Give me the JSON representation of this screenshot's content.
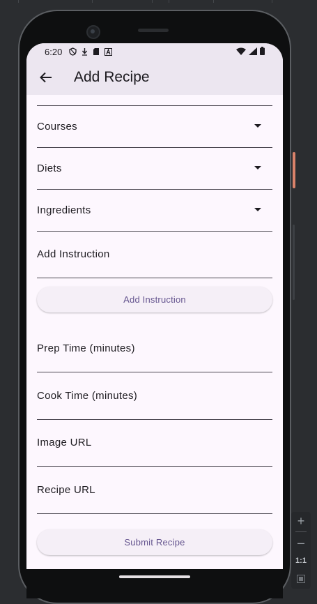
{
  "status_bar": {
    "time": "6:20",
    "left_icons": [
      "shield-icon",
      "download-icon",
      "sd-card-icon",
      "font-icon"
    ],
    "right_icons": [
      "wifi-icon",
      "signal-icon",
      "battery-icon"
    ]
  },
  "app_bar": {
    "title": "Add Recipe"
  },
  "form": {
    "courses_label": "Courses",
    "diets_label": "Diets",
    "ingredients_label": "Ingredients",
    "instruction_placeholder": "Add Instruction",
    "add_instruction_button": "Add Instruction",
    "prep_time_placeholder": "Prep Time (minutes)",
    "cook_time_placeholder": "Cook Time (minutes)",
    "image_url_placeholder": "Image URL",
    "recipe_url_placeholder": "Recipe URL",
    "submit_button": "Submit Recipe"
  },
  "emulator_toolbar": {
    "zoom_in": "+",
    "zoom_out": "–",
    "actual_size": "1:1"
  },
  "colors": {
    "app_bar": "#ece6f0",
    "background": "#fdf7fe",
    "button_text": "#65558f",
    "accent_side_button": "#d9826a"
  }
}
